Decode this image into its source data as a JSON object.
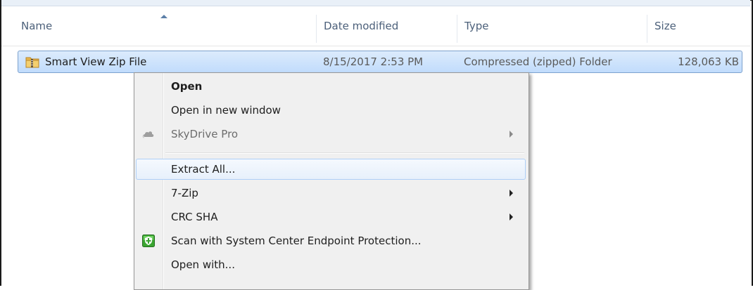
{
  "columns": {
    "name": "Name",
    "date_modified": "Date modified",
    "type": "Type",
    "size": "Size"
  },
  "file": {
    "name": "Smart View Zip File",
    "date_modified": "8/15/2017 2:53 PM",
    "type": "Compressed (zipped) Folder",
    "size": "128,063 KB",
    "icon": "zip-folder-icon"
  },
  "context_menu": {
    "items": [
      {
        "label": "Open",
        "style": "bold"
      },
      {
        "label": "Open in new window"
      },
      {
        "label": "SkyDrive Pro",
        "disabled": true,
        "submenu": true,
        "icon": "skydrive-cloud-icon"
      },
      {
        "label": "Extract All...",
        "highlighted": true
      },
      {
        "label": "7-Zip",
        "submenu": true
      },
      {
        "label": "CRC SHA",
        "submenu": true
      },
      {
        "label": "Scan with System Center Endpoint Protection...",
        "icon": "endpoint-protection-icon"
      },
      {
        "label": "Open with..."
      }
    ]
  },
  "colors": {
    "selection": "#cce2fc",
    "selection_border": "#7da2ce",
    "menu_bg": "#f0f0f0",
    "header_text": "#4c607a"
  }
}
